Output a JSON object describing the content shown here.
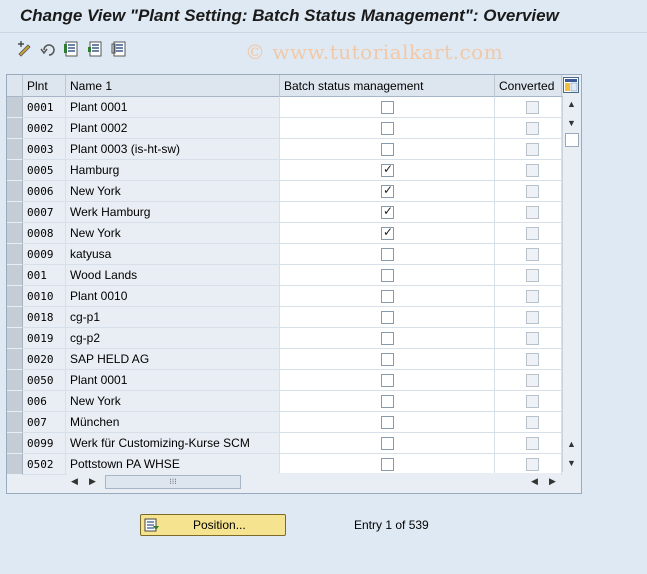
{
  "window": {
    "title": "Change View \"Plant Setting: Batch Status Management\": Overview"
  },
  "watermark": "© www.tutorialkart.com",
  "toolbar": {
    "icons": [
      "display-change-icon",
      "undo-icon",
      "select-all-icon",
      "select-block-icon",
      "deselect-all-icon"
    ]
  },
  "table": {
    "columns": {
      "plant": "Plnt",
      "name": "Name 1",
      "batch": "Batch status management",
      "converted": "Converted"
    },
    "rows": [
      {
        "plant": "0001",
        "name": "Plant 0001",
        "batch": false,
        "converted": false
      },
      {
        "plant": "0002",
        "name": "Plant 0002",
        "batch": false,
        "converted": false
      },
      {
        "plant": "0003",
        "name": "Plant 0003 (is-ht-sw)",
        "batch": false,
        "converted": false
      },
      {
        "plant": "0005",
        "name": "Hamburg",
        "batch": true,
        "converted": false
      },
      {
        "plant": "0006",
        "name": "New York",
        "batch": true,
        "converted": false
      },
      {
        "plant": "0007",
        "name": "Werk Hamburg",
        "batch": true,
        "converted": false
      },
      {
        "plant": "0008",
        "name": "New York",
        "batch": true,
        "converted": false
      },
      {
        "plant": "0009",
        "name": "katyusa",
        "batch": false,
        "converted": false
      },
      {
        "plant": "001",
        "name": "Wood Lands",
        "batch": false,
        "converted": false
      },
      {
        "plant": "0010",
        "name": "Plant 0010",
        "batch": false,
        "converted": false
      },
      {
        "plant": "0018",
        "name": "cg-p1",
        "batch": false,
        "converted": false
      },
      {
        "plant": "0019",
        "name": "cg-p2",
        "batch": false,
        "converted": false
      },
      {
        "plant": "0020",
        "name": "SAP HELD AG",
        "batch": false,
        "converted": false
      },
      {
        "plant": "0050",
        "name": "Plant 0001",
        "batch": false,
        "converted": false
      },
      {
        "plant": "006",
        "name": "New York",
        "batch": false,
        "converted": false
      },
      {
        "plant": "007",
        "name": "München",
        "batch": false,
        "converted": false
      },
      {
        "plant": "0099",
        "name": "Werk für Customizing-Kurse SCM",
        "batch": false,
        "converted": false
      },
      {
        "plant": "0502",
        "name": "Pottstown PA WHSE",
        "batch": false,
        "converted": false
      }
    ]
  },
  "footer": {
    "position_label": "Position...",
    "entry_text": "Entry 1 of 539"
  },
  "colors": {
    "background": "#dfe9f3",
    "button": "#f6e38f",
    "watermark": "#f1c9a8"
  }
}
